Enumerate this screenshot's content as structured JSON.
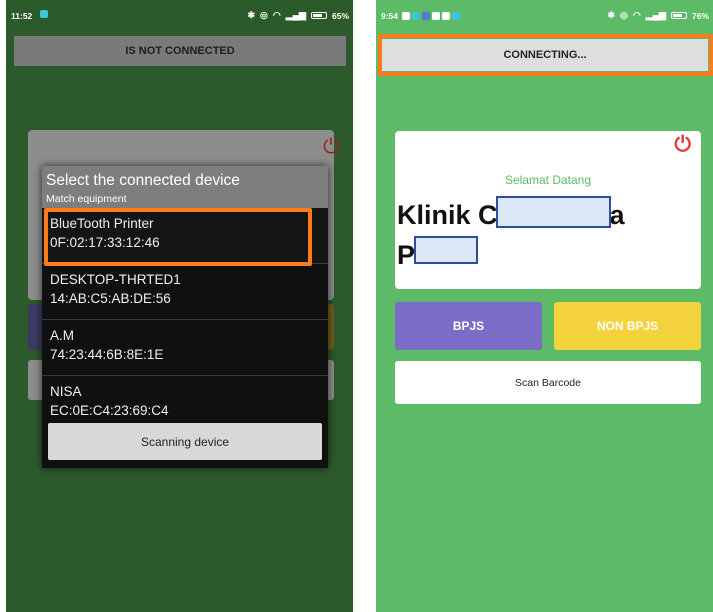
{
  "left_phone": {
    "status": {
      "time": "11:52",
      "battery": "65%"
    },
    "connection_status": "IS NOT CONNECTED",
    "dialog": {
      "title": "Select the connected device",
      "subtitle": "Match equipment",
      "devices": [
        {
          "name": "BlueTooth Printer",
          "address": "0F:02:17:33:12:46"
        },
        {
          "name": "DESKTOP-THRTED1",
          "address": "14:AB:C5:AB:DE:56"
        },
        {
          "name": "A.M",
          "address": "74:23:44:6B:8E:1E"
        },
        {
          "name": "NISA",
          "address": "EC:0E:C4:23:69:C4"
        }
      ],
      "scan_button": "Scanning device"
    }
  },
  "right_phone": {
    "status": {
      "time": "9:54",
      "battery": "76%"
    },
    "connection_status": "CONNECTING...",
    "card": {
      "welcome": "Selamat Datang",
      "clinic_line1": "Klinik C",
      "clinic_line1_end": "a",
      "clinic_line2": "P"
    },
    "buttons": {
      "bpjs": "BPJS",
      "non_bpjs": "NON BPJS",
      "scan_barcode": "Scan Barcode"
    }
  },
  "colors": {
    "highlight": "#ff7a1a",
    "app_green": "#5dba66",
    "bpjs_purple": "#7c6bc7",
    "nonbpjs_yellow": "#f4d23c"
  }
}
